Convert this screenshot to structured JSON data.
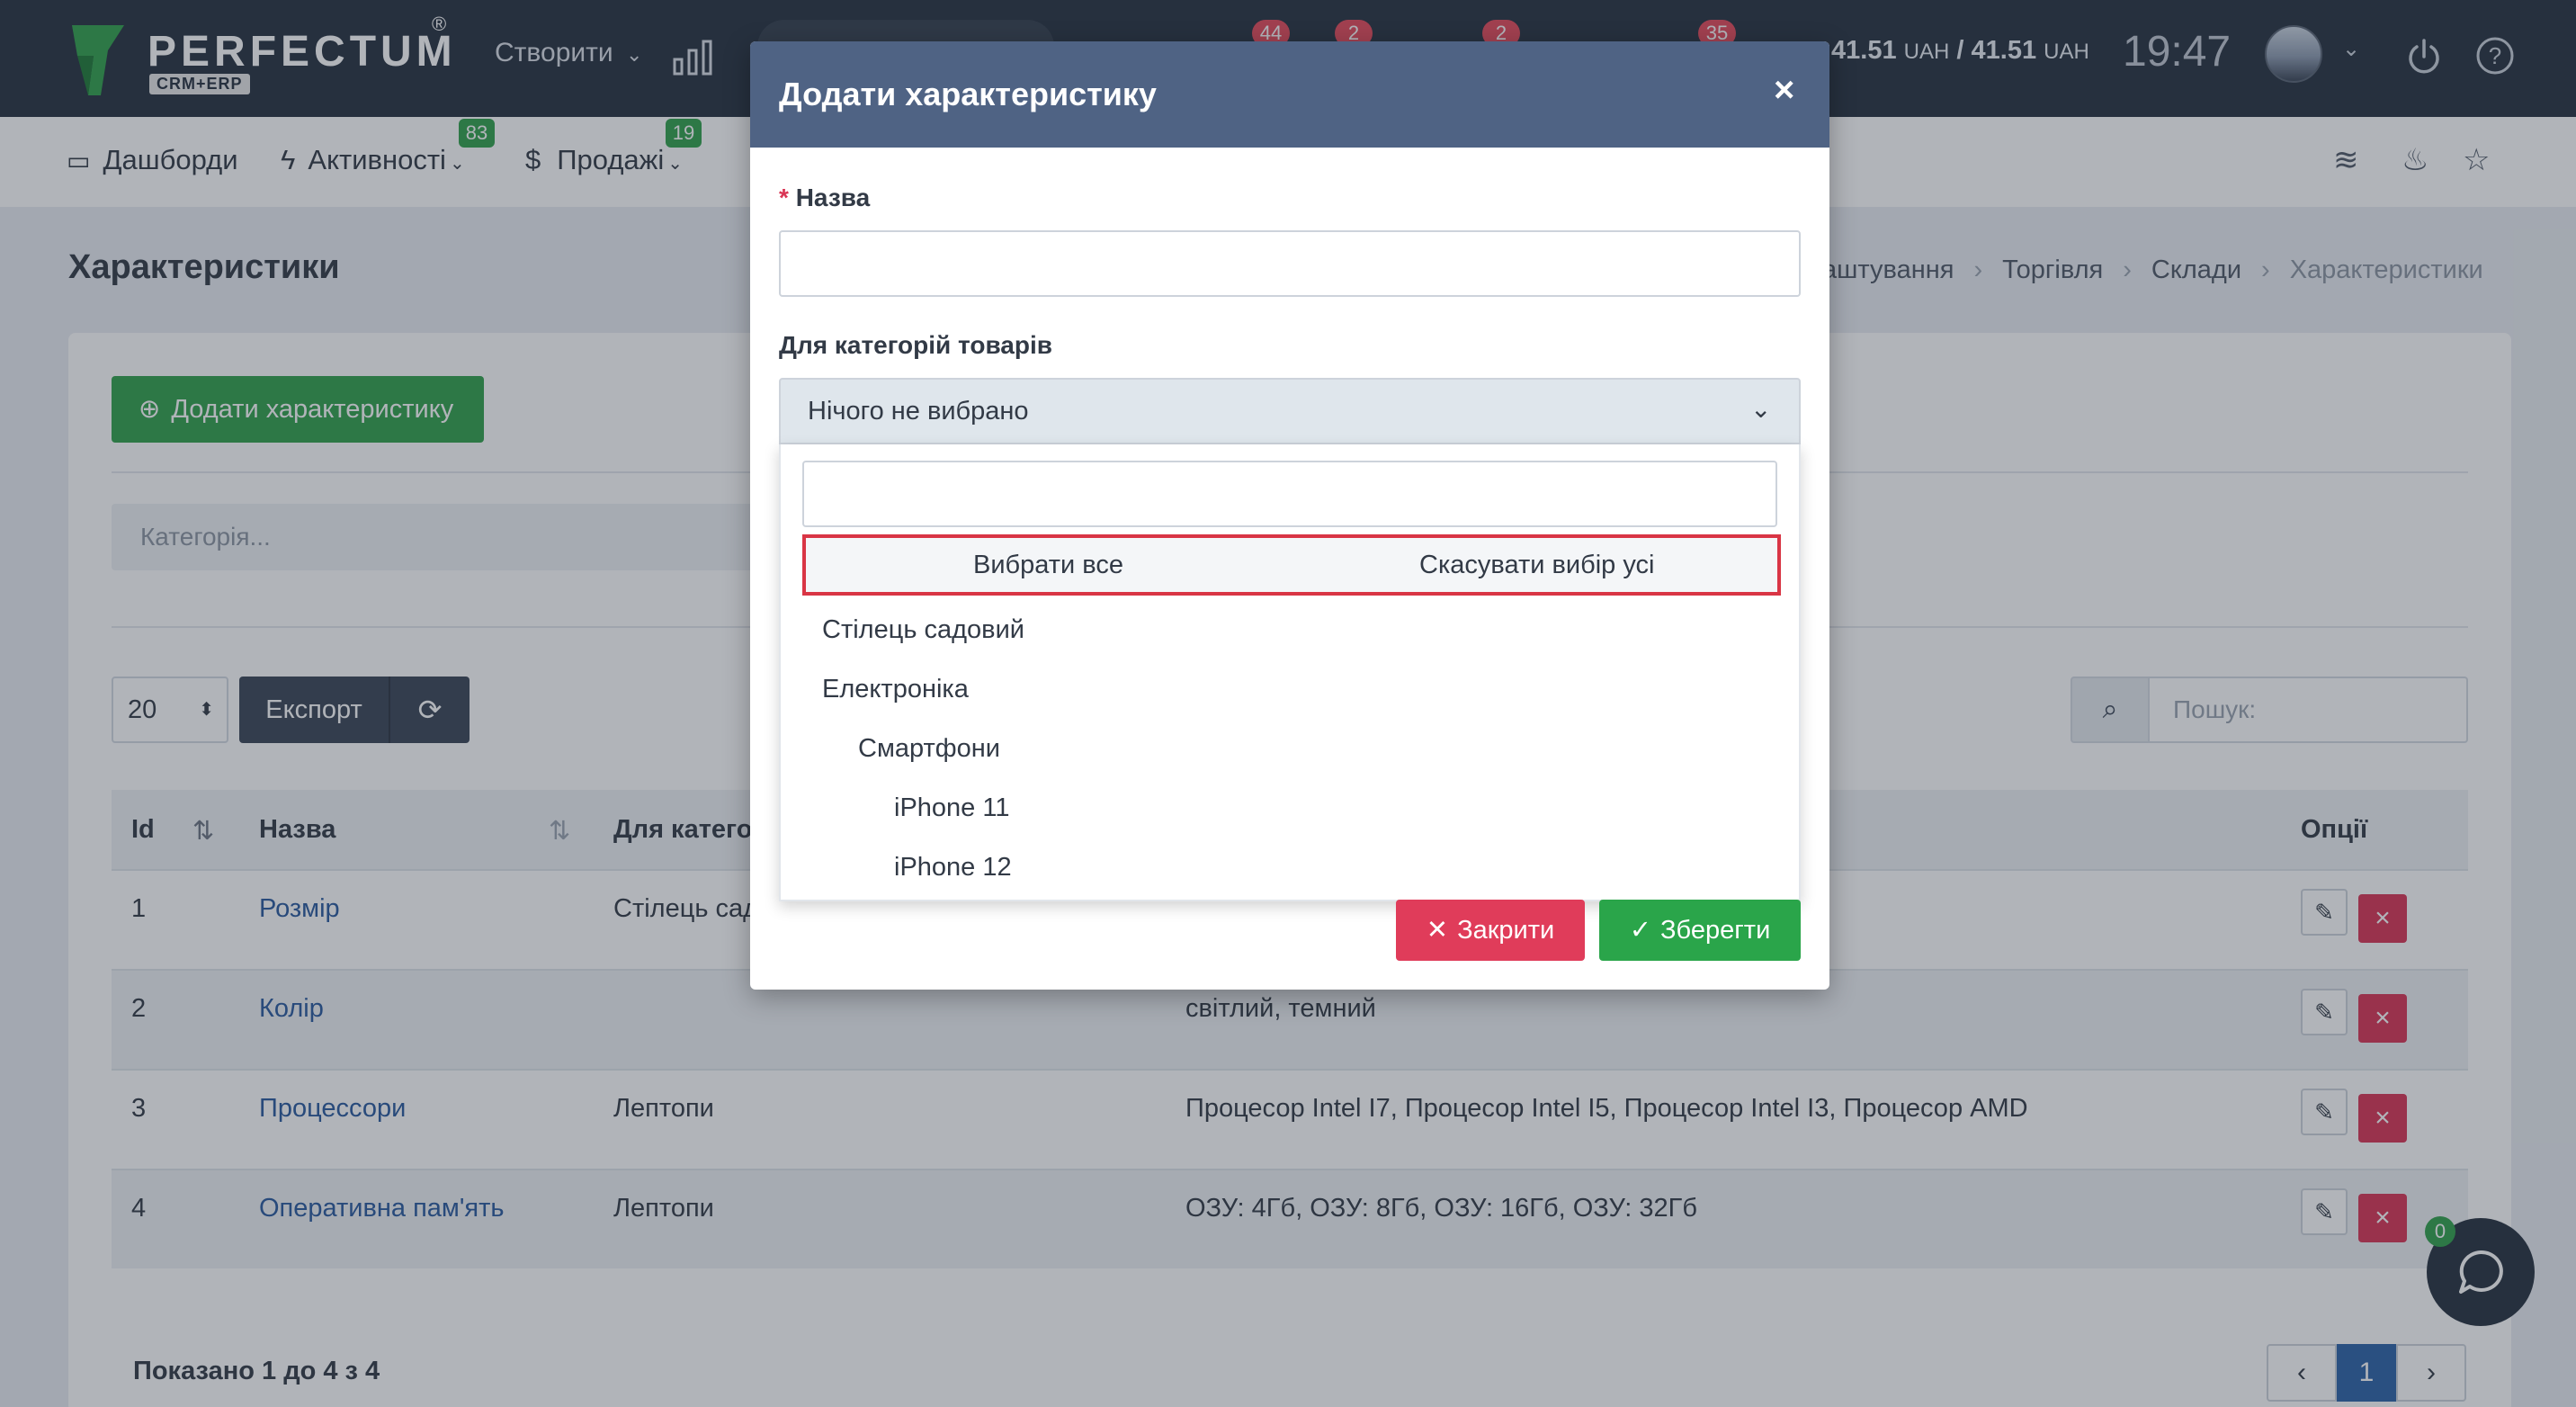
{
  "app": {
    "logo_text": "PERFECTUM",
    "logo_reg": "®",
    "logo_sub": "CRM+ERP"
  },
  "topbar": {
    "create_label": "Створити",
    "badges": [
      "44",
      "2",
      "2",
      "35"
    ],
    "currency": "41.51",
    "currency_unit": "UAH",
    "currency_sep": "/",
    "currency2": "41.51",
    "currency2_unit": "UAH",
    "clock": "19:47"
  },
  "nav": {
    "dashboards": "Дашборди",
    "activities": "Активності",
    "activities_badge": "83",
    "sales": "Продажі",
    "sales_badge": "19"
  },
  "page": {
    "title": "Характеристики",
    "breadcrumb": [
      "аштування",
      "Торгівля",
      "Склади",
      "Характеристики"
    ]
  },
  "toolbar": {
    "add_label": "Додати характеристику",
    "category_placeholder": "Категорія...",
    "page_size": "20",
    "export_label": "Експорт",
    "search_placeholder": "Пошук:"
  },
  "table": {
    "headers": [
      "Id",
      "Назва",
      "Для катего",
      "Опції"
    ],
    "rows": [
      {
        "id": "1",
        "name": "Розмір",
        "category": "Стілець сад",
        "values": ""
      },
      {
        "id": "2",
        "name": "Колір",
        "category": "",
        "values": "світлий, темний"
      },
      {
        "id": "3",
        "name": "Процессори",
        "category": "Лептопи",
        "values": "Процесор Intel I7, Процесор Intel I5, Процесор Intel I3, Процесор AMD"
      },
      {
        "id": "4",
        "name": "Оперативна пам'ять",
        "category": "Лептопи",
        "values": "ОЗУ: 4Гб, ОЗУ: 8Гб, ОЗУ: 16Гб, ОЗУ: 32Гб"
      }
    ],
    "showing": "Показано 1 до 4 з 4",
    "current_page": "1"
  },
  "chat": {
    "badge": "0"
  },
  "modal": {
    "title": "Додати характеристику",
    "close_symbol": "×",
    "name_label": "Назва",
    "categories_label": "Для категорій товарів",
    "select_value": "Нічого не вибрано",
    "select_all": "Вибрати все",
    "deselect_all": "Скасувати вибір усі",
    "options": [
      "Стілець садовий",
      "Електроніка",
      "Смартфони",
      "iPhone 11",
      "iPhone 12"
    ],
    "close_button": "Закрити",
    "save_button": "Зберегти"
  },
  "colors": {
    "topbar": "#27313f",
    "modal_header": "#4f6384",
    "primary_green": "#31a24c",
    "danger": "#d93555",
    "highlight_border": "#d93545",
    "link": "#2a5a9e"
  }
}
